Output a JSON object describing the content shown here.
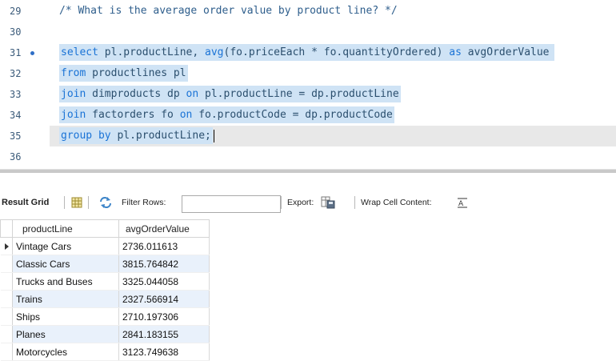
{
  "editor": {
    "lines": [
      {
        "no": "29",
        "text": "/* What is the average order value by product line? */"
      },
      {
        "no": "30",
        "text": ""
      },
      {
        "no": "31",
        "text": "select pl.productLine, avg(fo.priceEach * fo.quantityOrdered) as avgOrderValue"
      },
      {
        "no": "32",
        "text": "from productlines pl"
      },
      {
        "no": "33",
        "text": "join dimproducts dp on pl.productLine = dp.productLine"
      },
      {
        "no": "34",
        "text": "join factorders fo on fo.productCode = dp.productCode"
      },
      {
        "no": "35",
        "text": "group by pl.productLine;"
      },
      {
        "no": "36",
        "text": ""
      }
    ],
    "l31_a": "select",
    "l31_b": " pl.productLine, ",
    "l31_c": "avg",
    "l31_d": "(fo.priceEach * fo.quantityOrdered) ",
    "l31_e": "as",
    "l31_f": " avgOrderValue",
    "l32_a": "from",
    "l32_b": " productlines pl",
    "l33_a": "join",
    "l33_b": " dimproducts dp ",
    "l33_c": "on",
    "l33_d": " pl.productLine = dp.productLine",
    "l34_a": "join",
    "l34_b": " factorders fo ",
    "l34_c": "on",
    "l34_d": " fo.productCode = dp.productCode",
    "l35_a": "group by",
    "l35_b": " pl.productLine;"
  },
  "toolbar": {
    "result_grid": "Result Grid",
    "filter_rows": "Filter Rows:",
    "filter_value": "",
    "export": "Export:",
    "wrap": "Wrap Cell Content:",
    "grid_icon": "grid-icon",
    "refresh_icon": "refresh-icon",
    "export_icon": "export-icon",
    "wrap_icon": "wrap-icon"
  },
  "grid": {
    "columns": [
      "productLine",
      "avgOrderValue"
    ],
    "rows": [
      [
        "Vintage Cars",
        "2736.011613"
      ],
      [
        "Classic Cars",
        "3815.764842"
      ],
      [
        "Trucks and Buses",
        "3325.044058"
      ],
      [
        "Trains",
        "2327.566914"
      ],
      [
        "Ships",
        "2710.197306"
      ],
      [
        "Planes",
        "2841.183155"
      ],
      [
        "Motorcycles",
        "3123.749638"
      ]
    ]
  },
  "colors": {
    "keyword": "#1a73d6",
    "selection": "#cfe3f5",
    "alt_row": "#e9f1fb"
  }
}
